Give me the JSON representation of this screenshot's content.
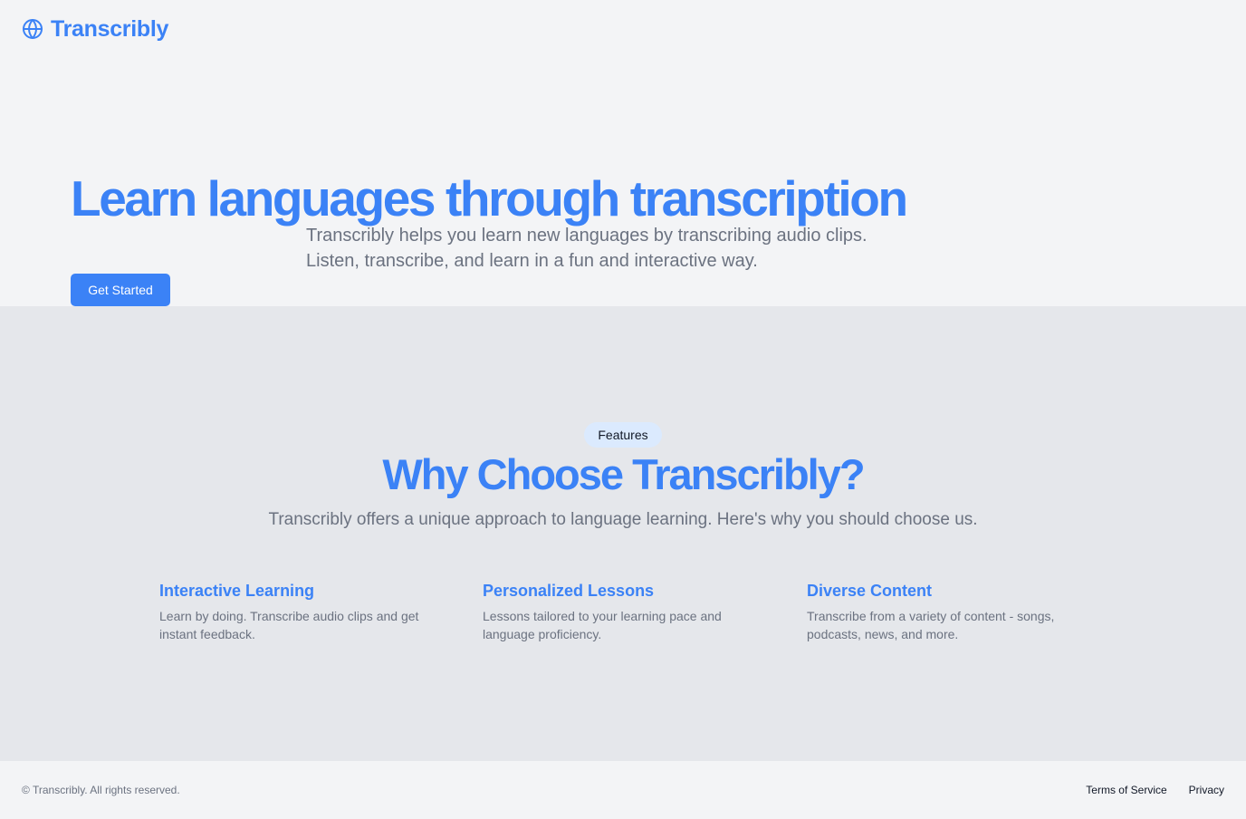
{
  "header": {
    "logo_icon": "globe-icon",
    "brand": "Transcribly"
  },
  "hero": {
    "title": "Learn languages through transcription",
    "subtitle_line1": "Transcribly helps you learn new languages by transcribing audio clips.",
    "subtitle_line2": "Listen, transcribe, and learn in a fun and interactive way.",
    "cta_label": "Get Started"
  },
  "features": {
    "badge": "Features",
    "title": "Why Choose Transcribly?",
    "subtitle": "Transcribly offers a unique approach to language learning. Here's why you should choose us.",
    "items": [
      {
        "title": "Interactive Learning",
        "description": "Learn by doing. Transcribe audio clips and get instant feedback."
      },
      {
        "title": "Personalized Lessons",
        "description": "Lessons tailored to your learning pace and language proficiency."
      },
      {
        "title": "Diverse Content",
        "description": "Transcribe from a variety of content - songs, podcasts, news, and more."
      }
    ]
  },
  "footer": {
    "copyright": "© Transcribly. All rights reserved.",
    "links": [
      {
        "label": "Terms of Service"
      },
      {
        "label": "Privacy"
      }
    ]
  },
  "colors": {
    "accent": "#3b82f6",
    "background": "#f3f4f6",
    "features_background": "#e5e7eb",
    "badge_background": "#dbeafe",
    "muted_text": "#6b7280"
  }
}
